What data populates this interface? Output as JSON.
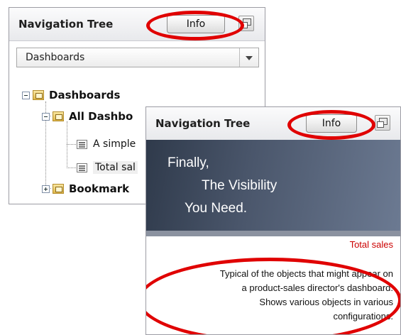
{
  "panel1": {
    "title": "Navigation Tree",
    "info_label": "Info",
    "dropdown_value": "Dashboards",
    "tree": {
      "root": "Dashboards",
      "folder": "All Dashbo",
      "item1": "A simple",
      "item2": "Total sal",
      "bookmarks": "Bookmark"
    }
  },
  "panel2": {
    "title": "Navigation Tree",
    "info_label": "Info",
    "banner": {
      "line1": "Finally,",
      "line2": "The Visibility",
      "line3": "You Need."
    },
    "selected_name": "Total sales",
    "description": [
      "Typical of the objects that might appear on",
      "a product-sales director's dashboard.",
      "Shows various objects in various",
      "configurations."
    ]
  },
  "colors": {
    "highlight": "#e00000",
    "link_red": "#cc0000",
    "banner": "#3d4758"
  }
}
